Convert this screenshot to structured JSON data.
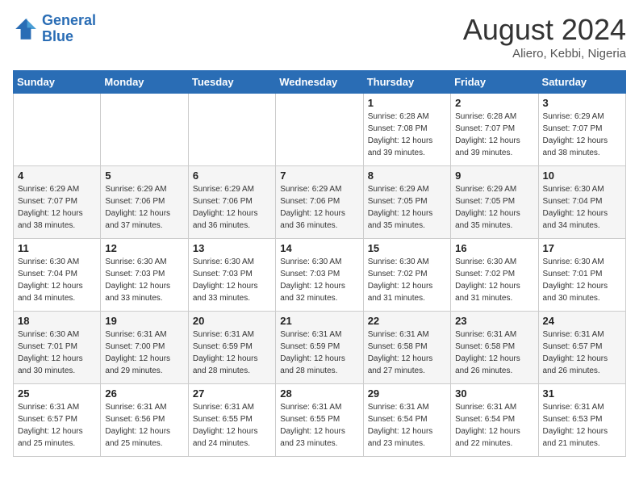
{
  "logo": {
    "line1": "General",
    "line2": "Blue"
  },
  "title": "August 2024",
  "location": "Aliero, Kebbi, Nigeria",
  "days_of_week": [
    "Sunday",
    "Monday",
    "Tuesday",
    "Wednesday",
    "Thursday",
    "Friday",
    "Saturday"
  ],
  "weeks": [
    [
      {
        "day": "",
        "info": ""
      },
      {
        "day": "",
        "info": ""
      },
      {
        "day": "",
        "info": ""
      },
      {
        "day": "",
        "info": ""
      },
      {
        "day": "1",
        "info": "Sunrise: 6:28 AM\nSunset: 7:08 PM\nDaylight: 12 hours\nand 39 minutes."
      },
      {
        "day": "2",
        "info": "Sunrise: 6:28 AM\nSunset: 7:07 PM\nDaylight: 12 hours\nand 39 minutes."
      },
      {
        "day": "3",
        "info": "Sunrise: 6:29 AM\nSunset: 7:07 PM\nDaylight: 12 hours\nand 38 minutes."
      }
    ],
    [
      {
        "day": "4",
        "info": "Sunrise: 6:29 AM\nSunset: 7:07 PM\nDaylight: 12 hours\nand 38 minutes."
      },
      {
        "day": "5",
        "info": "Sunrise: 6:29 AM\nSunset: 7:06 PM\nDaylight: 12 hours\nand 37 minutes."
      },
      {
        "day": "6",
        "info": "Sunrise: 6:29 AM\nSunset: 7:06 PM\nDaylight: 12 hours\nand 36 minutes."
      },
      {
        "day": "7",
        "info": "Sunrise: 6:29 AM\nSunset: 7:06 PM\nDaylight: 12 hours\nand 36 minutes."
      },
      {
        "day": "8",
        "info": "Sunrise: 6:29 AM\nSunset: 7:05 PM\nDaylight: 12 hours\nand 35 minutes."
      },
      {
        "day": "9",
        "info": "Sunrise: 6:29 AM\nSunset: 7:05 PM\nDaylight: 12 hours\nand 35 minutes."
      },
      {
        "day": "10",
        "info": "Sunrise: 6:30 AM\nSunset: 7:04 PM\nDaylight: 12 hours\nand 34 minutes."
      }
    ],
    [
      {
        "day": "11",
        "info": "Sunrise: 6:30 AM\nSunset: 7:04 PM\nDaylight: 12 hours\nand 34 minutes."
      },
      {
        "day": "12",
        "info": "Sunrise: 6:30 AM\nSunset: 7:03 PM\nDaylight: 12 hours\nand 33 minutes."
      },
      {
        "day": "13",
        "info": "Sunrise: 6:30 AM\nSunset: 7:03 PM\nDaylight: 12 hours\nand 33 minutes."
      },
      {
        "day": "14",
        "info": "Sunrise: 6:30 AM\nSunset: 7:03 PM\nDaylight: 12 hours\nand 32 minutes."
      },
      {
        "day": "15",
        "info": "Sunrise: 6:30 AM\nSunset: 7:02 PM\nDaylight: 12 hours\nand 31 minutes."
      },
      {
        "day": "16",
        "info": "Sunrise: 6:30 AM\nSunset: 7:02 PM\nDaylight: 12 hours\nand 31 minutes."
      },
      {
        "day": "17",
        "info": "Sunrise: 6:30 AM\nSunset: 7:01 PM\nDaylight: 12 hours\nand 30 minutes."
      }
    ],
    [
      {
        "day": "18",
        "info": "Sunrise: 6:30 AM\nSunset: 7:01 PM\nDaylight: 12 hours\nand 30 minutes."
      },
      {
        "day": "19",
        "info": "Sunrise: 6:31 AM\nSunset: 7:00 PM\nDaylight: 12 hours\nand 29 minutes."
      },
      {
        "day": "20",
        "info": "Sunrise: 6:31 AM\nSunset: 6:59 PM\nDaylight: 12 hours\nand 28 minutes."
      },
      {
        "day": "21",
        "info": "Sunrise: 6:31 AM\nSunset: 6:59 PM\nDaylight: 12 hours\nand 28 minutes."
      },
      {
        "day": "22",
        "info": "Sunrise: 6:31 AM\nSunset: 6:58 PM\nDaylight: 12 hours\nand 27 minutes."
      },
      {
        "day": "23",
        "info": "Sunrise: 6:31 AM\nSunset: 6:58 PM\nDaylight: 12 hours\nand 26 minutes."
      },
      {
        "day": "24",
        "info": "Sunrise: 6:31 AM\nSunset: 6:57 PM\nDaylight: 12 hours\nand 26 minutes."
      }
    ],
    [
      {
        "day": "25",
        "info": "Sunrise: 6:31 AM\nSunset: 6:57 PM\nDaylight: 12 hours\nand 25 minutes."
      },
      {
        "day": "26",
        "info": "Sunrise: 6:31 AM\nSunset: 6:56 PM\nDaylight: 12 hours\nand 25 minutes."
      },
      {
        "day": "27",
        "info": "Sunrise: 6:31 AM\nSunset: 6:55 PM\nDaylight: 12 hours\nand 24 minutes."
      },
      {
        "day": "28",
        "info": "Sunrise: 6:31 AM\nSunset: 6:55 PM\nDaylight: 12 hours\nand 23 minutes."
      },
      {
        "day": "29",
        "info": "Sunrise: 6:31 AM\nSunset: 6:54 PM\nDaylight: 12 hours\nand 23 minutes."
      },
      {
        "day": "30",
        "info": "Sunrise: 6:31 AM\nSunset: 6:54 PM\nDaylight: 12 hours\nand 22 minutes."
      },
      {
        "day": "31",
        "info": "Sunrise: 6:31 AM\nSunset: 6:53 PM\nDaylight: 12 hours\nand 21 minutes."
      }
    ]
  ]
}
